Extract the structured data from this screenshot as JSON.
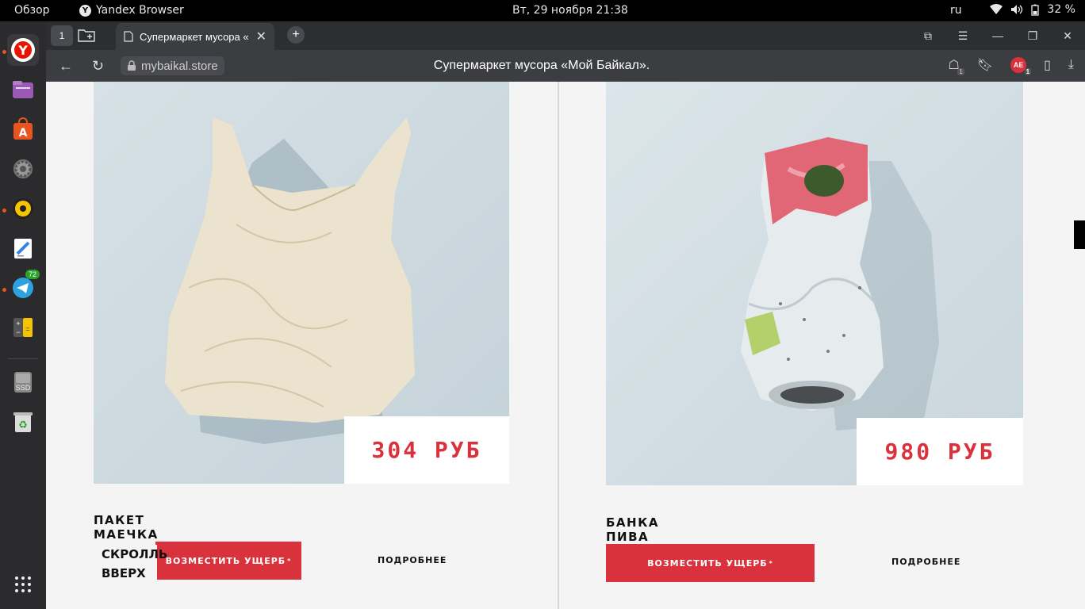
{
  "system": {
    "overview": "Обзор",
    "app_name": "Yandex Browser",
    "clock": "Вт, 29 ноября  21:38",
    "lang": "ru",
    "battery": "32 %"
  },
  "dock": {
    "badge_telegram": "72",
    "ssd_label": "SSD"
  },
  "browser": {
    "tab_count": "1",
    "tab_title": "Супермаркет мусора «",
    "url": "mybaikal.store",
    "page_title": "Супермаркет мусора «Мой Байкал».",
    "ae_badge": "AE",
    "ae_count": "1",
    "protect_count": "1"
  },
  "products": [
    {
      "name": "ПАКЕТ МАЕЧКА",
      "price": "304 РУБ",
      "buy_label": "ВОЗМЕСТИТЬ УЩЕРБ",
      "more_label": "ПОДРОБНЕЕ"
    },
    {
      "name": "БАНКА ПИВА",
      "price": "980 РУБ",
      "buy_label": "ВОЗМЕСТИТЬ УЩЕРБ",
      "more_label": "ПОДРОБНЕЕ"
    }
  ],
  "scroll_up": {
    "line1": "СКРОЛЛЬ",
    "line2": "ВВЕРХ"
  },
  "colors": {
    "accent": "#d9323c",
    "page_bg": "#f4f4f4",
    "photo_bg": "#cfdbe0"
  }
}
